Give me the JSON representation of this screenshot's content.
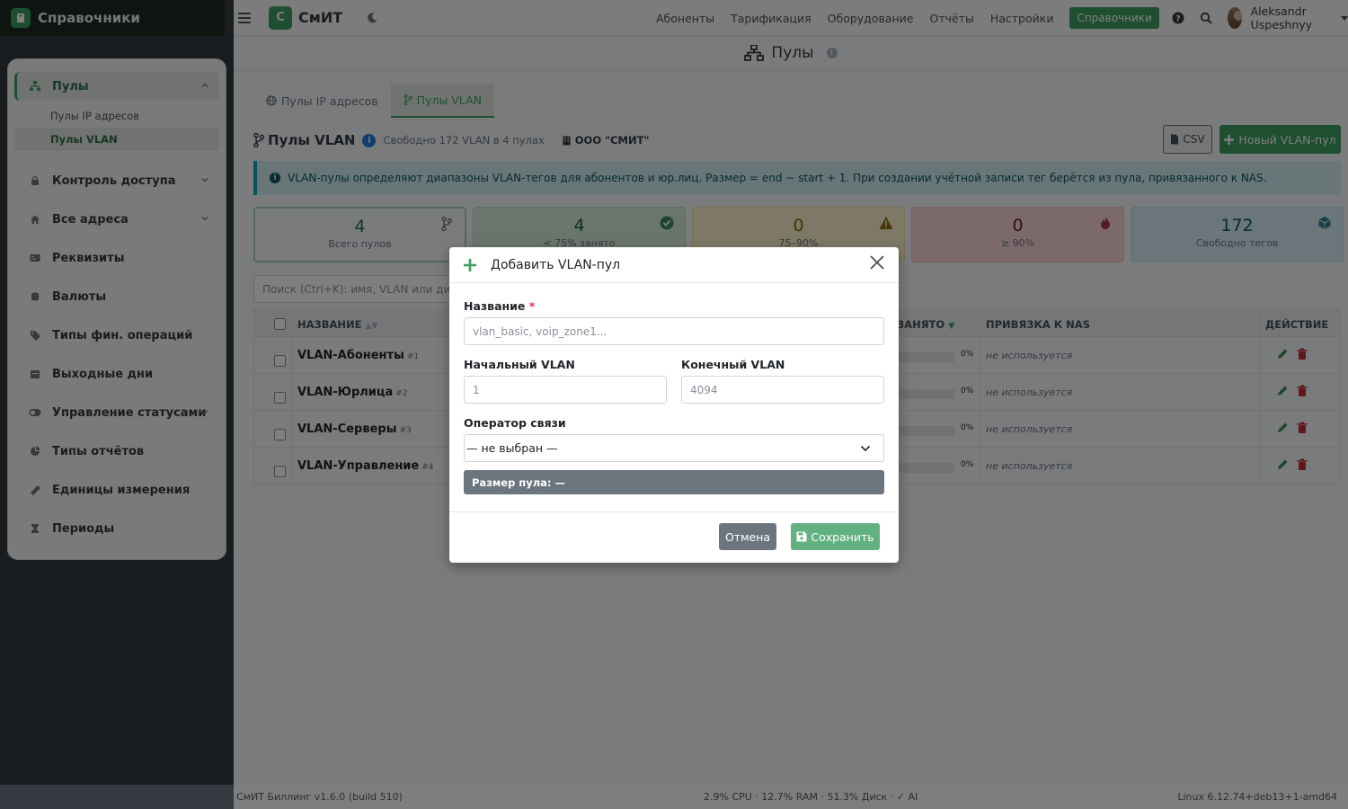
{
  "sidebar": {
    "brand": "Справочники",
    "items": [
      {
        "label": "Пулы",
        "icon": "sitemap-icon"
      },
      {
        "label": "Контроль доступа",
        "icon": "lock-icon"
      },
      {
        "label": "Все адреса",
        "icon": "home-icon"
      },
      {
        "label": "Реквизиты",
        "icon": "id-card-icon"
      },
      {
        "label": "Валюты",
        "icon": "coins-icon"
      },
      {
        "label": "Типы фин. операций",
        "icon": "tags-icon"
      },
      {
        "label": "Выходные дни",
        "icon": "calendar-icon"
      },
      {
        "label": "Управление статусами",
        "icon": "toggle-icon"
      },
      {
        "label": "Типы отчётов",
        "icon": "chart-pie-icon"
      },
      {
        "label": "Единицы измерения",
        "icon": "ruler-icon"
      },
      {
        "label": "Периоды",
        "icon": "hourglass-icon"
      }
    ],
    "subitems": [
      "Пулы IP адресов",
      "Пулы VLAN"
    ]
  },
  "topbar": {
    "logo_letter": "С",
    "logo_text": "СмИТ",
    "nav": [
      "Абоненты",
      "Тарификация",
      "Оборудование",
      "Отчёты",
      "Настройки",
      "Справочники"
    ],
    "user": "Aleksandr Uspeshnyy"
  },
  "page": {
    "title": "Пулы",
    "info_glyph": "i",
    "tabs": [
      "Пулы IP адресов",
      "Пулы VLAN"
    ]
  },
  "section": {
    "title": "Пулы VLAN",
    "info_glyph": "i",
    "free_text": "Свободно 172 VLAN в 4 пулах",
    "org": "ООО \"СМИТ\"",
    "csv_label": "CSV",
    "new_label": "Новый VLAN-пул",
    "alert": "VLAN-пулы определяют диапазоны VLAN-тегов для абонентов и юр.лиц. Размер = end − start + 1. При создании учётной записи тег берётся из пула, привязанного к NAS."
  },
  "stats": [
    {
      "value": "4",
      "label": "Всего пулов"
    },
    {
      "value": "4",
      "label": "< 75% занято"
    },
    {
      "value": "0",
      "label": "75–90%"
    },
    {
      "value": "0",
      "label": "≥ 90%"
    },
    {
      "value": "172",
      "label": "Свободно тегов"
    }
  ],
  "search": {
    "placeholder": "Поиск (Ctrl+K): имя, VLAN или диапазон"
  },
  "table": {
    "headers": {
      "name": "НАЗВАНИЕ",
      "busy": "ЗАНЯТО",
      "nas": "ПРИВЯЗКА К NAS",
      "action": "ДЕЙСТВИЕ"
    },
    "rows": [
      {
        "name": "VLAN-Абоненты",
        "id": "#1",
        "pct": "0%",
        "nas": "не используется"
      },
      {
        "name": "VLAN-Юрлица",
        "id": "#2",
        "pct": "0%",
        "nas": "не используется"
      },
      {
        "name": "VLAN-Серверы",
        "id": "#3",
        "pct": "0%",
        "nas": "не используется"
      },
      {
        "name": "VLAN-Управление",
        "id": "#4",
        "pct": "0%",
        "nas": "не используется"
      }
    ]
  },
  "modal": {
    "title": "Добавить VLAN-пул",
    "name_label": "Название",
    "required_mark": "*",
    "name_placeholder": "vlan_basic, voip_zone1...",
    "start_label": "Начальный VLAN",
    "start_placeholder": "1",
    "end_label": "Конечный VLAN",
    "end_placeholder": "4094",
    "operator_label": "Оператор связи",
    "operator_value": "— не выбран —",
    "size_text": "Размер пула: —",
    "cancel_label": "Отмена",
    "save_label": "Сохранить"
  },
  "footer": {
    "left": "СмИТ Биллинг v1.6.0 (build 510)",
    "center": "2.9% CPU · 12.7% RAM · 51.3% Диск · ✓ AI",
    "right": "Linux 6.12.74+deb13+1-amd64"
  },
  "colors": {
    "brand": "#3b9e61",
    "sidebar": "#343a40",
    "info": "#17a2b8"
  }
}
